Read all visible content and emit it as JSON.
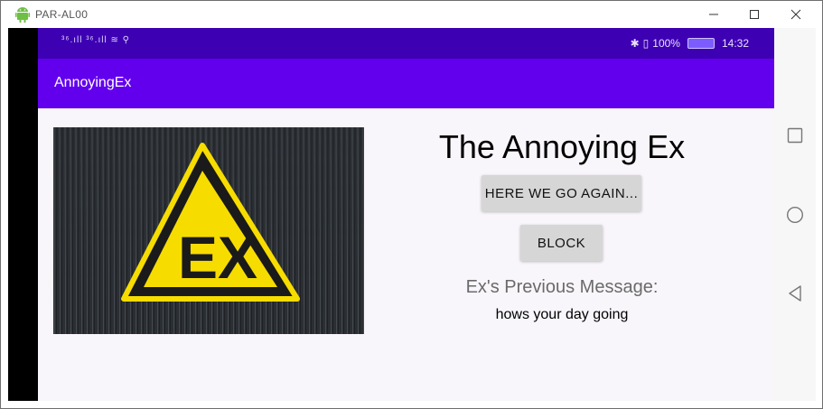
{
  "window": {
    "title": "PAR-AL00"
  },
  "statusbar": {
    "signal_left": "³⁶.ıll ³⁶.ıll ≋ ⚲",
    "battery_text": "100%",
    "time": "14:32"
  },
  "appbar": {
    "title": "AnnoyingEx"
  },
  "hero": {
    "sign_text": "EX",
    "bg_color": "#2b2f33",
    "sign_yellow": "#f7dc00"
  },
  "main": {
    "heading": "The Annoying Ex",
    "again_button": "HERE WE GO AGAIN...",
    "block_button": "BLOCK",
    "prev_label": "Ex's Previous Message:",
    "prev_message": "hows your day going"
  },
  "colors": {
    "status_bar": "#3e00b3",
    "app_bar": "#6200ee"
  }
}
